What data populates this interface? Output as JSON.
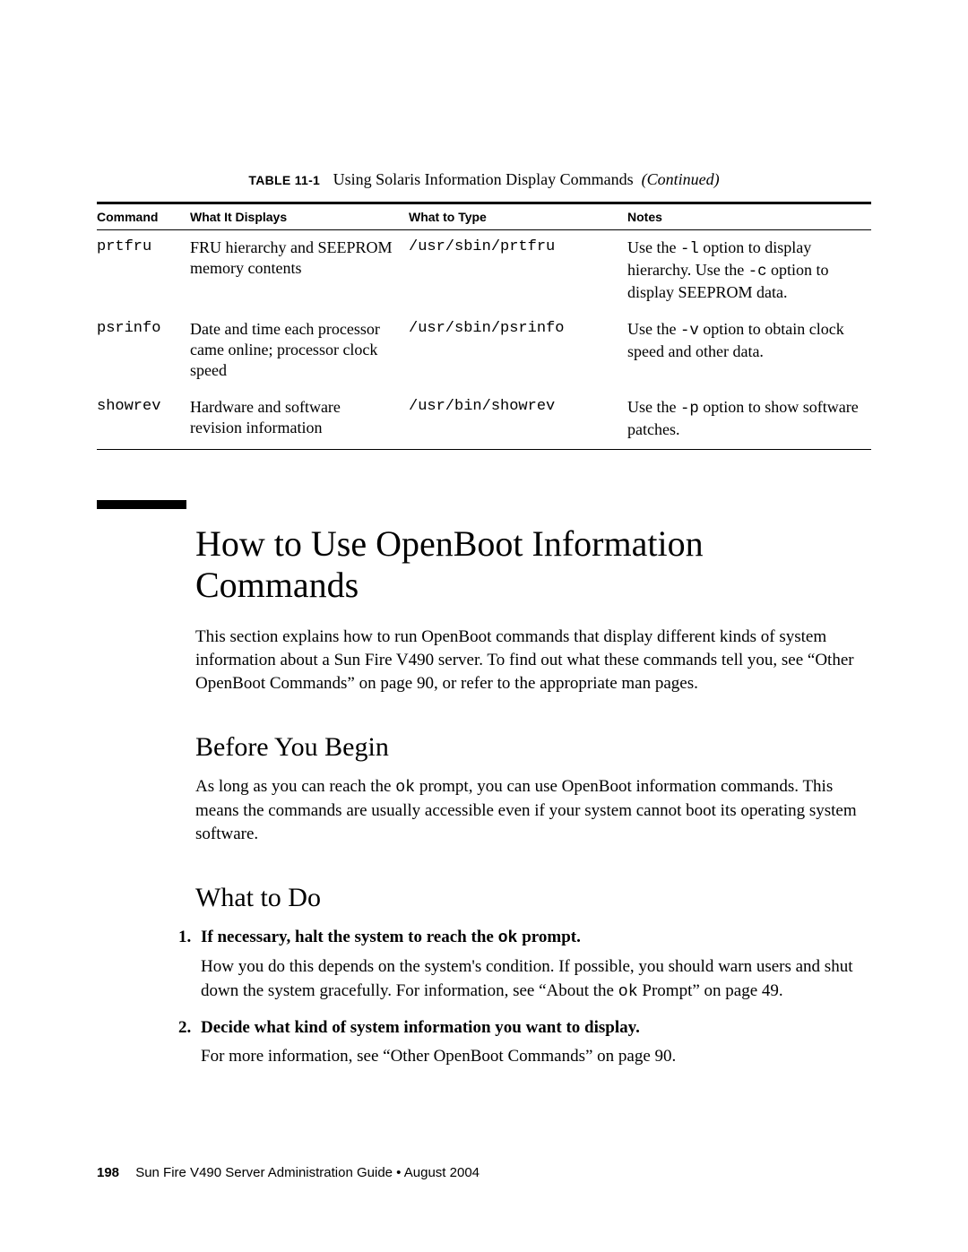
{
  "caption": {
    "label": "TABLE 11-1",
    "title": "Using Solaris Information Display Commands",
    "suffix": "(Continued)"
  },
  "table": {
    "headers": [
      "Command",
      "What It Displays",
      "What to Type",
      "Notes"
    ],
    "rows": [
      {
        "command": "prtfru",
        "displays": "FRU hierarchy and SEEPROM memory contents",
        "type": "/usr/sbin/prtfru",
        "notes_pre1": "Use the ",
        "notes_code1": "-l",
        "notes_mid1": " option to display hierarchy. Use the ",
        "notes_code2": "-c",
        "notes_post1": " option to display SEEPROM data."
      },
      {
        "command": "psrinfo",
        "displays": "Date and time each processor came online; processor clock speed",
        "type": "/usr/sbin/psrinfo",
        "notes_pre1": "Use the ",
        "notes_code1": "-v",
        "notes_mid1": " option to obtain clock speed and other data.",
        "notes_code2": "",
        "notes_post1": ""
      },
      {
        "command": "showrev",
        "displays": "Hardware and software revision information",
        "type": "/usr/bin/showrev",
        "notes_pre1": "Use the ",
        "notes_code1": "-p",
        "notes_mid1": " option to show software patches.",
        "notes_code2": "",
        "notes_post1": ""
      }
    ]
  },
  "section": {
    "heading": "How to Use OpenBoot Information Commands",
    "intro": "This section explains how to run OpenBoot commands that display different kinds of system information about a Sun Fire V490 server. To find out what these commands tell you, see “Other OpenBoot Commands” on page 90, or refer to the appropriate man pages."
  },
  "before": {
    "heading": "Before You Begin",
    "text_pre": "As long as you can reach the ",
    "text_code": "ok",
    "text_post": " prompt, you can use OpenBoot information commands. This means the commands are usually accessible even if your system cannot boot its operating system software."
  },
  "todo": {
    "heading": "What to Do",
    "items": [
      {
        "title_pre": "If necessary, halt the system to reach the ",
        "title_code": "ok",
        "title_post": " prompt.",
        "body_pre": "How you do this depends on the system's condition. If possible, you should warn users and shut down the system gracefully. For information, see “About the ",
        "body_code": "ok",
        "body_post": " Prompt” on page 49."
      },
      {
        "title_pre": "Decide what kind of system information you want to display.",
        "title_code": "",
        "title_post": "",
        "body_pre": "For more information, see “Other OpenBoot Commands” on page 90.",
        "body_code": "",
        "body_post": ""
      }
    ]
  },
  "footer": {
    "page": "198",
    "text": "Sun Fire V490 Server Administration Guide • August 2004"
  }
}
